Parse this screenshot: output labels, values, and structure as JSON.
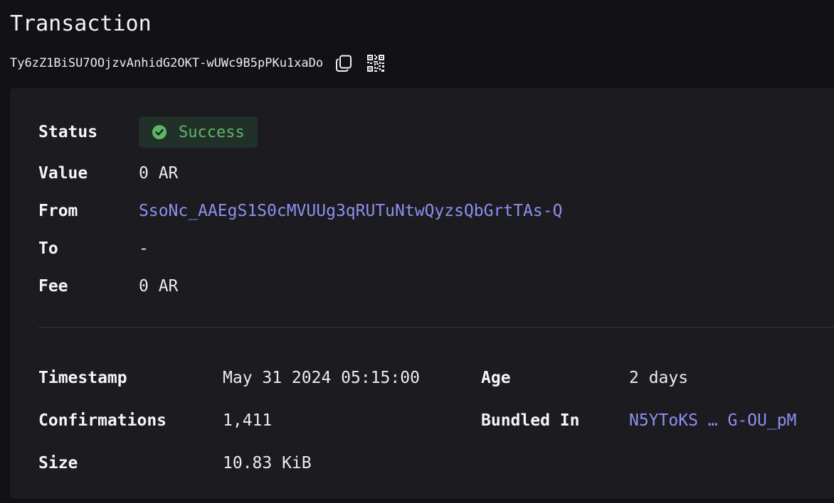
{
  "header": {
    "title": "Transaction",
    "tx_id": "Ty6zZ1BiSU7OOjzvAnhidG2OKT-wUWc9B5pPKu1xaDo"
  },
  "icons": {
    "copy": "copy-icon",
    "qr": "qr-code-icon",
    "status": "check-circle-icon"
  },
  "colors": {
    "background": "#121216",
    "card": "#1b1b20",
    "link": "#8f8ff0",
    "success_text": "#5cb865",
    "success_bg": "#22302a"
  },
  "summary": {
    "status_label": "Status",
    "status_value": "Success",
    "value_label": "Value",
    "value": "0 AR",
    "from_label": "From",
    "from_value": "SsoNc_AAEgS1S0cMVUUg3qRUTuNtwQyzsQbGrtTAs-Q",
    "to_label": "To",
    "to_value": "-",
    "fee_label": "Fee",
    "fee_value": "0 AR"
  },
  "details": {
    "timestamp_label": "Timestamp",
    "timestamp_value": "May 31 2024 05:15:00",
    "age_label": "Age",
    "age_value": "2 days",
    "confirmations_label": "Confirmations",
    "confirmations_value": "1,411",
    "bundled_label": "Bundled In",
    "bundled_value": "N5YToKS … G-OU_pM",
    "size_label": "Size",
    "size_value": "10.83 KiB"
  }
}
